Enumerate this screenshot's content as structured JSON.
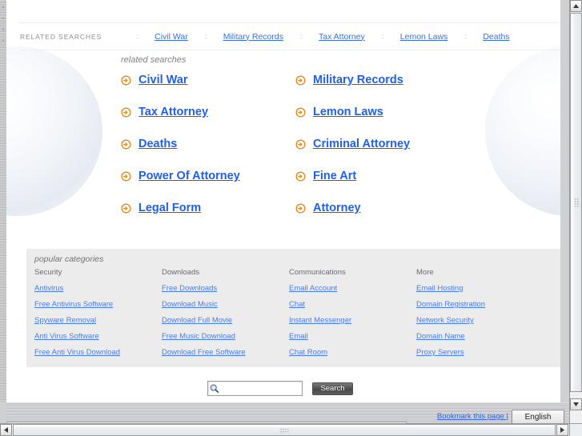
{
  "related_bar": {
    "label": "RELATED SEARCHES",
    "separator": "::",
    "links": [
      "Civil War",
      "Military Records",
      "Tax Attorney",
      "Lemon Laws",
      "Deaths"
    ]
  },
  "related_block": {
    "title": "related searches",
    "icon": "arrow-circle-right-icon",
    "accent": "#e08a1e",
    "link_color": "#2060e8",
    "rows": [
      {
        "left": "Civil War",
        "right": "Military Records"
      },
      {
        "left": "Tax Attorney",
        "right": "Lemon Laws"
      },
      {
        "left": "Deaths",
        "right": "Criminal Attorney"
      },
      {
        "left": "Power Of Attorney",
        "right": "Fine Art"
      },
      {
        "left": "Legal Form",
        "right": "Attorney"
      }
    ]
  },
  "popular": {
    "title": "popular categories",
    "columns": [
      {
        "heading": "Security",
        "links": [
          "Antivirus",
          "Free Antivirus Software",
          "Spyware Removal",
          "Anti Virus Software",
          "Free Anti Virus Download"
        ]
      },
      {
        "heading": "Downloads",
        "links": [
          "Free Downloads",
          "Download Music",
          "Download Full Movie",
          "Free Music Download",
          "Download Free Software"
        ]
      },
      {
        "heading": "Communications",
        "links": [
          "Email Account",
          "Chat",
          "Instant Messenger",
          "Email",
          "Chat Room"
        ]
      },
      {
        "heading": "More",
        "links": [
          "Email Hosting",
          "Domain Registration",
          "Network Security",
          "Domain Name",
          "Proxy Servers"
        ]
      }
    ]
  },
  "search": {
    "icon": "magnifier-icon",
    "value": "",
    "placeholder": "",
    "button_label": "Search"
  },
  "footer": {
    "bookmark_label": "Bookmark this page |",
    "language": "English"
  },
  "scrollbars": {
    "v_up_icon": "triangle-up-icon",
    "v_down_icon": "triangle-down-icon",
    "h_left_icon": "triangle-left-icon",
    "h_right_icon": "triangle-right-icon"
  }
}
